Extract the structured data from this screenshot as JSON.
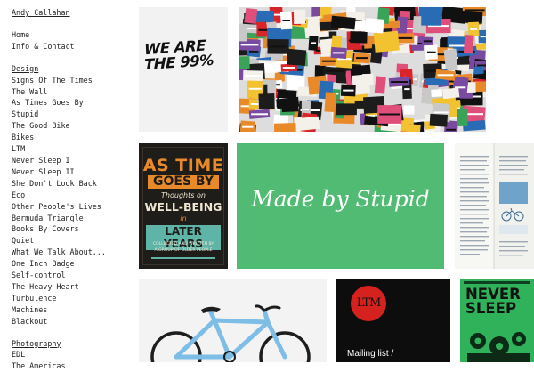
{
  "sidebar": {
    "site_name": "Andy Callahan",
    "top_links": [
      "Home",
      "Info & Contact"
    ],
    "design_heading": "Design",
    "design_items": [
      "Signs Of The Times",
      "The Wall",
      "As Times Goes By",
      "Stupid",
      "The Good Bike",
      "Bikes",
      "LTM",
      "Never Sleep I",
      "Never Sleep II",
      "She Don't Look Back",
      "Eco",
      "Other People's Lives",
      "Bermuda Triangle",
      "Books By Covers",
      "Quiet",
      "What We Talk About...",
      "One Inch Badge",
      "Self-control",
      "The Heavy Heart",
      "Turbulence",
      "Machines",
      "Blackout"
    ],
    "photography_heading": "Photography",
    "photography_items": [
      "EDL",
      "The Americas"
    ]
  },
  "tiles": {
    "we99_text": "WE ARE THE 99%",
    "astime": {
      "line1": "AS TIME",
      "line2": "GOES BY",
      "line3": "Thoughts on",
      "line4": "WELL-BEING",
      "line5": "in",
      "line6": "LATER YEARS",
      "line7": "COLLECTED AND WRITTEN BY",
      "line8": "A GROUP OF OLDER PEOPLE"
    },
    "stupid_text": "Made by Stupid",
    "ltm_logo": "LTM",
    "ltm_caption": "Mailing list /",
    "never_title_1": "NEVER",
    "never_title_2": "SLEEP"
  },
  "colors": {
    "stupid_green": "#52bb73",
    "ltm_red": "#d5221f",
    "never_green": "#2fb25a",
    "astime_orange": "#e98a2a",
    "astime_teal": "#5fb4a8"
  }
}
